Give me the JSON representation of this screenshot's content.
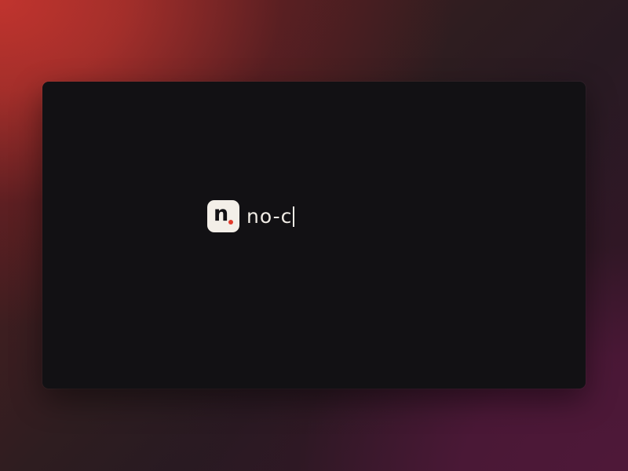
{
  "app": {
    "logo": {
      "letter": "n",
      "icon": "n-logo-icon",
      "accent_color": "#e23b2c"
    },
    "typed_text": "no-c"
  },
  "colors": {
    "window_background": "#121114",
    "text": "#f1ede6",
    "logo_tile": "#f3efe8"
  }
}
